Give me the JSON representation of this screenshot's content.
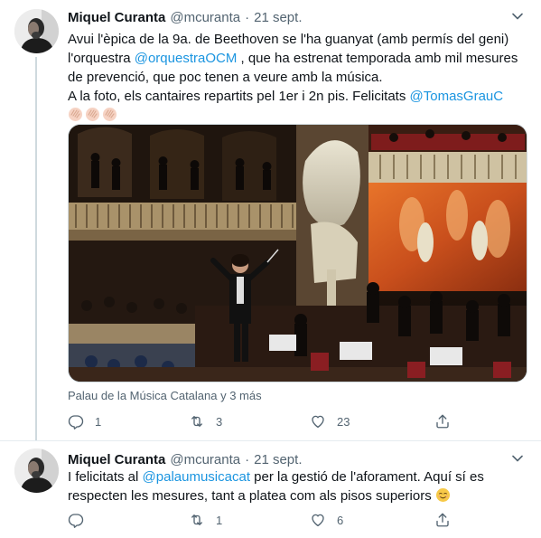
{
  "tweets": [
    {
      "author_name": "Miquel Curanta",
      "handle": "@mcuranta",
      "separator": "·",
      "date": "21 sept.",
      "text_1": "Avui l'èpica de la 9a. de Beethoven se  l'ha guanyat (amb permís del geni) l'orquestra ",
      "mention_1": "@orquestraOCM",
      "text_2": " , que ha estrenat temporada amb mil mesures de prevenció, que poc tenen a veure amb la música.",
      "text_3": "A la foto, els cantaires repartits pel 1er i 2n pis. Felicitats ",
      "mention_2": "@TomasGrauC",
      "emoji": "clapping-hands x3",
      "location": "Palau de la Música Catalana y 3 más",
      "replies": "1",
      "retweets": "3",
      "likes": "23"
    },
    {
      "author_name": "Miquel Curanta",
      "handle": "@mcuranta",
      "separator": "·",
      "date": "21 sept.",
      "text_1": "I felicitats al ",
      "mention_1": "@palaumusicacat",
      "text_2": " per la gestió de l'aforament. Aquí sí es respecten les mesures, tant a platea com als pisos superiors ",
      "emoji": "relieved-face",
      "replies": "",
      "retweets": "1",
      "likes": "6"
    }
  ],
  "icons": {
    "reply": "reply-icon",
    "retweet": "retweet-icon",
    "like": "like-icon",
    "share": "share-icon",
    "caret": "chevron-down-icon"
  },
  "colors": {
    "text": "#0f1419",
    "secondary": "#536471",
    "link": "#1b95e0",
    "border": "#cfd9de"
  }
}
